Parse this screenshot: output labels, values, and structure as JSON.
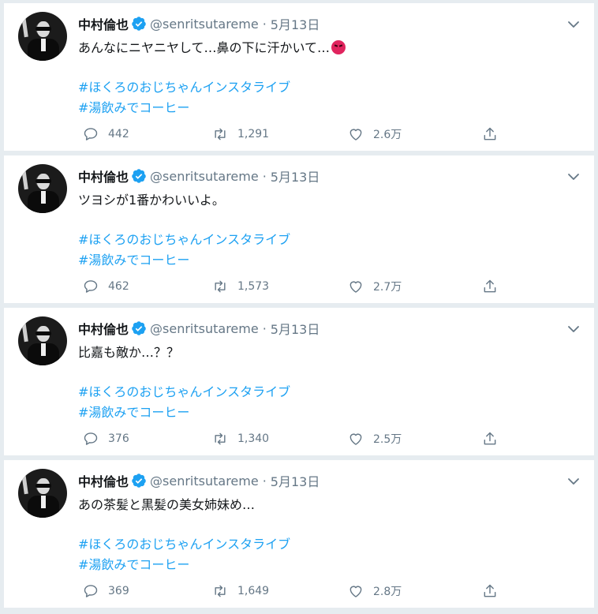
{
  "tweets": [
    {
      "name": "中村倫也",
      "handle": "@senritsutareme",
      "date": "5月13日",
      "text": "あんなにニヤニヤして…鼻の下に汗かいて…",
      "has_emoji": true,
      "hashtags": [
        "#ほくろのおじちゃんインスタライブ",
        "#湯飲みでコーヒー"
      ],
      "replies": "442",
      "retweets": "1,291",
      "likes": "2.6万"
    },
    {
      "name": "中村倫也",
      "handle": "@senritsutareme",
      "date": "5月13日",
      "text": "ツヨシが1番かわいいよ。",
      "has_emoji": false,
      "hashtags": [
        "#ほくろのおじちゃんインスタライブ",
        "#湯飲みでコーヒー"
      ],
      "replies": "462",
      "retweets": "1,573",
      "likes": "2.7万"
    },
    {
      "name": "中村倫也",
      "handle": "@senritsutareme",
      "date": "5月13日",
      "text": "比嘉も敵か…？？",
      "has_emoji": false,
      "hashtags": [
        "#ほくろのおじちゃんインスタライブ",
        "#湯飲みでコーヒー"
      ],
      "replies": "376",
      "retweets": "1,340",
      "likes": "2.5万"
    },
    {
      "name": "中村倫也",
      "handle": "@senritsutareme",
      "date": "5月13日",
      "text": "あの茶髪と黒髪の美女姉妹め…",
      "has_emoji": false,
      "hashtags": [
        "#ほくろのおじちゃんインスタライブ",
        "#湯飲みでコーヒー"
      ],
      "replies": "369",
      "retweets": "1,649",
      "likes": "2.8万"
    }
  ],
  "separator": "·",
  "icons": {
    "verified": "verified-badge-icon",
    "caret": "chevron-down-icon",
    "reply": "reply-bubble-icon",
    "retweet": "retweet-arrows-icon",
    "like": "heart-icon",
    "share": "share-upload-icon",
    "emoji": "angry-face-emoji"
  },
  "colors": {
    "accent": "#1da1f2",
    "muted": "#657786",
    "text": "#14171a",
    "background": "#e6ecf0",
    "emoji": "#e0245e"
  }
}
